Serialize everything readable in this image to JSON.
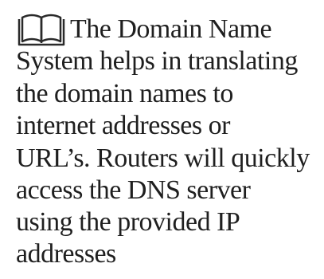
{
  "document": {
    "icon": "open-book-icon",
    "text_color": "#1f1f1f",
    "lines": [
      "The Domain Name",
      "System helps in translating",
      "the domain names to",
      "internet addresses or",
      "URL’s. Routers will quickly",
      "access the DNS server",
      "using the provided IP",
      "addresses"
    ]
  }
}
